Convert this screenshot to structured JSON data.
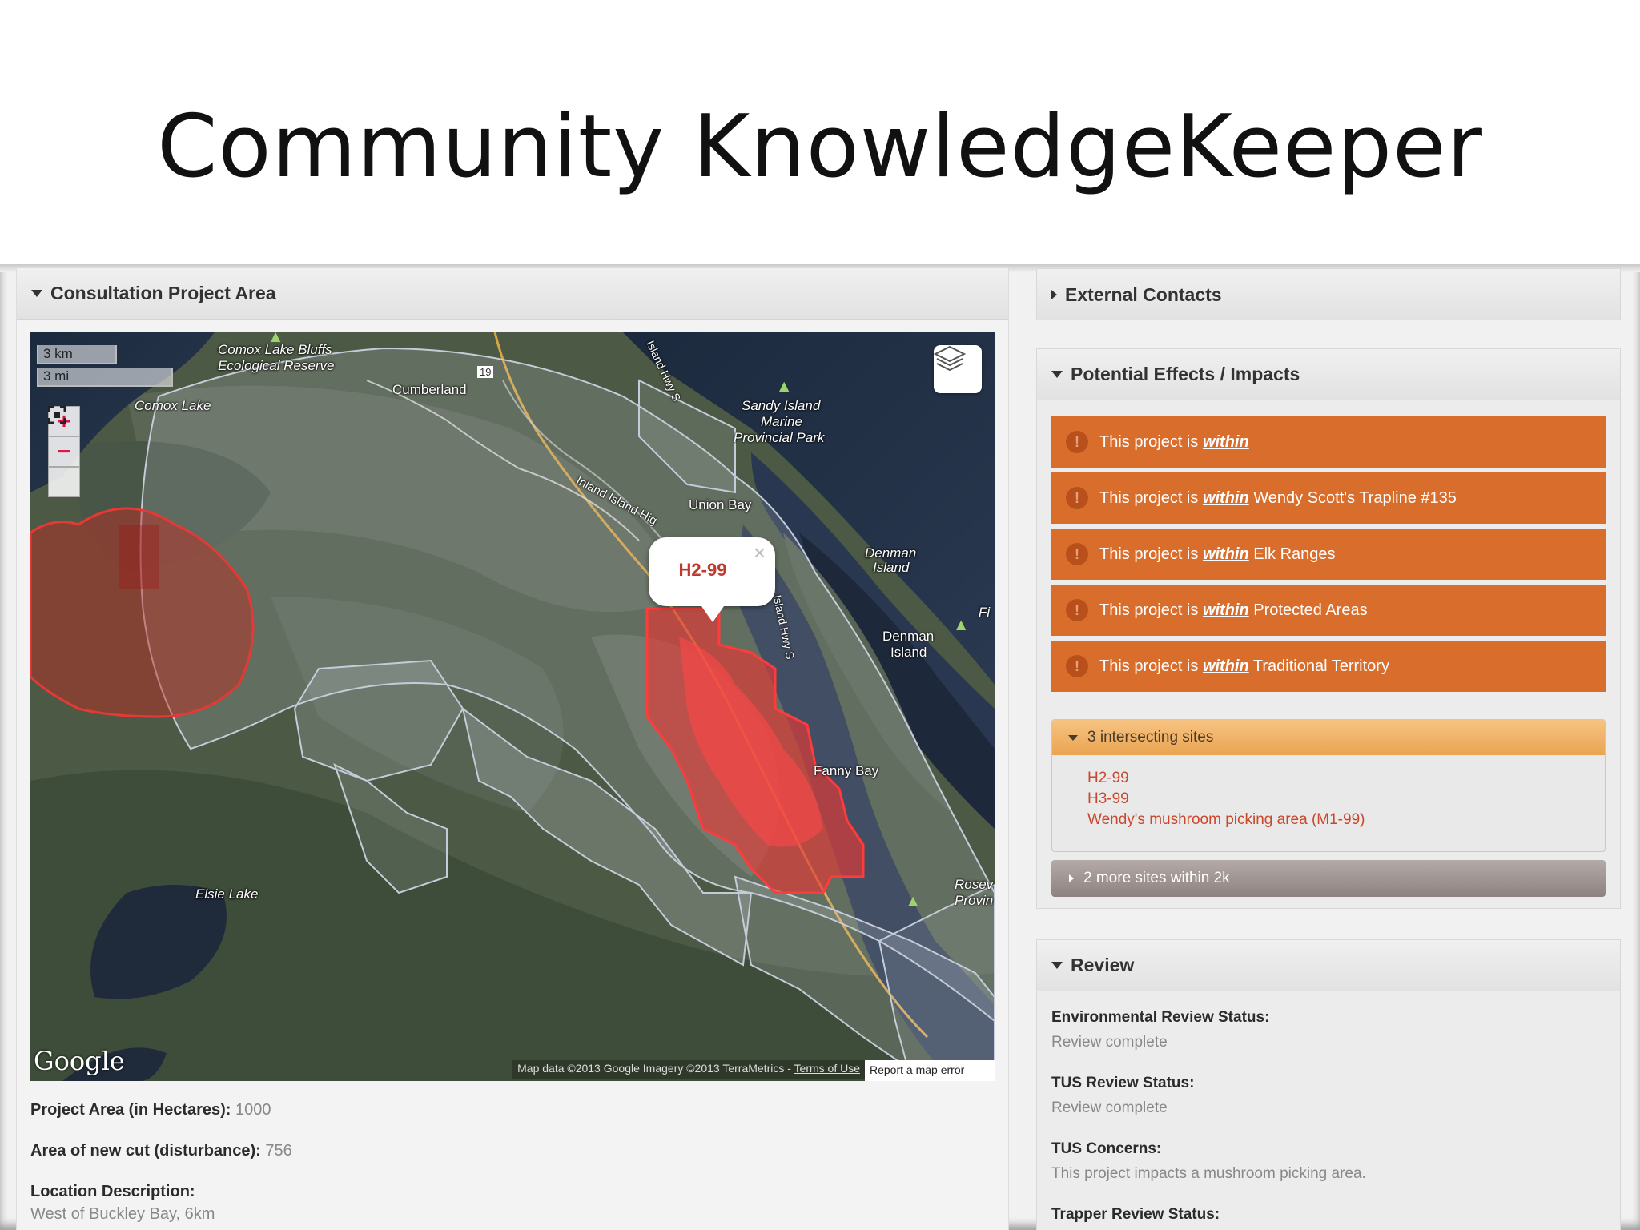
{
  "slide": {
    "title": "Community KnowledgeKeeper"
  },
  "left_panel": {
    "header": "Consultation Project Area",
    "map": {
      "scale_km": "3 km",
      "scale_mi": "3 mi",
      "zoom_in": "+",
      "zoom_out": "−",
      "labels": {
        "comox_lake_bluffs": "Comox Lake Bluffs",
        "ecological_reserve": "Ecological Reserve",
        "cumberland": "Cumberland",
        "comox_lake": "Comox Lake",
        "highway_19": "19",
        "island_hwy": "Island Hwy S",
        "sandy_island": "Sandy Island",
        "marine": "Marine",
        "provincial_park": "Provincial Park",
        "inland_island_hwy": "Inland Island Hig",
        "union_bay": "Union Bay",
        "denman_island_1": "Denman",
        "denman_island_1b": "Island",
        "denman_island_2": "Denman",
        "denman_island_2b": "Island",
        "fanny_bay": "Fanny Bay",
        "elsie_lake": "Elsie Lake",
        "rosewall": "Rosev",
        "provin": "Provin",
        "fi": "Fi",
        "island_hwy_2": "Island Hwy S"
      },
      "popup": {
        "text": "H2-99",
        "close": "×"
      },
      "google": "Google",
      "attribution": "Map data ©2013 Google Imagery ©2013 TerraMetrics - ",
      "terms": "Terms of Use",
      "report": "Report a map error"
    },
    "fields": {
      "project_area_label": "Project Area (in Hectares):",
      "project_area_value": "1000",
      "new_cut_label": "Area of new cut (disturbance):",
      "new_cut_value": "756",
      "location_label": "Location Description:",
      "location_value": "West of Buckley Bay, 6km"
    }
  },
  "right_panel": {
    "external_contacts": "External Contacts",
    "effects_header": "Potential Effects / Impacts",
    "effects": [
      {
        "prefix": "This project is",
        "within": "within",
        "suffix": ""
      },
      {
        "prefix": "This project is",
        "within": "within",
        "suffix": "Wendy Scott's Trapline #135"
      },
      {
        "prefix": "This project is",
        "within": "within",
        "suffix": "Elk Ranges"
      },
      {
        "prefix": "This project is",
        "within": "within",
        "suffix": "Protected Areas"
      },
      {
        "prefix": "This project is",
        "within": "within",
        "suffix": "Traditional Territory"
      }
    ],
    "warn_symbol": "!",
    "intersecting_header": "3 intersecting sites",
    "sites": [
      "H2-99",
      "H3-99",
      "Wendy's mushroom picking area (M1-99)"
    ],
    "more_sites": "2 more sites within 2k",
    "review": {
      "header": "Review",
      "env_label": "Environmental Review Status:",
      "env_value": "Review complete",
      "tus_label": "TUS Review Status:",
      "tus_value": "Review complete",
      "concerns_label": "TUS Concerns:",
      "concerns_value": "This project impacts a mushroom picking area.",
      "trapper_label": "Trapper Review Status:"
    }
  },
  "colors": {
    "effect_orange": "#d96e2c",
    "site_link": "#c9472a",
    "header_orange": "#e9a450",
    "impact_red": "#e53935"
  }
}
